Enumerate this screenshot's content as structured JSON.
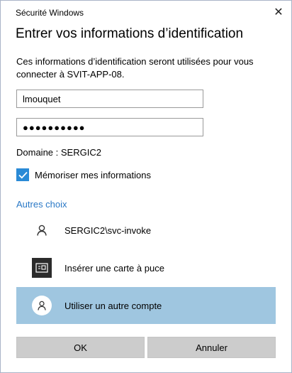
{
  "window": {
    "title": "Sécurité Windows",
    "close_glyph": "✕"
  },
  "heading": "Entrer vos informations d’identification",
  "description": "Ces informations d’identification seront utilisées pour vous connecter à SVIT-APP-08.",
  "fields": {
    "username_value": "lmouquet",
    "password_mask": "●●●●●●●●●●"
  },
  "domain": "Domaine : SERGIC2",
  "remember": {
    "label": "Mémoriser mes informations",
    "checked": true
  },
  "other_choices": {
    "label": "Autres choix",
    "items": [
      {
        "label": "SERGIC2\\svc-invoke",
        "icon": "person-icon"
      },
      {
        "label": "Insérer une carte à puce",
        "icon": "smartcard-icon"
      },
      {
        "label": "Utiliser un autre compte",
        "icon": "person-icon"
      }
    ]
  },
  "buttons": {
    "ok": "OK",
    "cancel": "Annuler"
  },
  "colors": {
    "accent": "#2a8ad6",
    "link": "#2a78c6",
    "selected_row": "#9fc6e0",
    "button_bg": "#cccccc"
  }
}
